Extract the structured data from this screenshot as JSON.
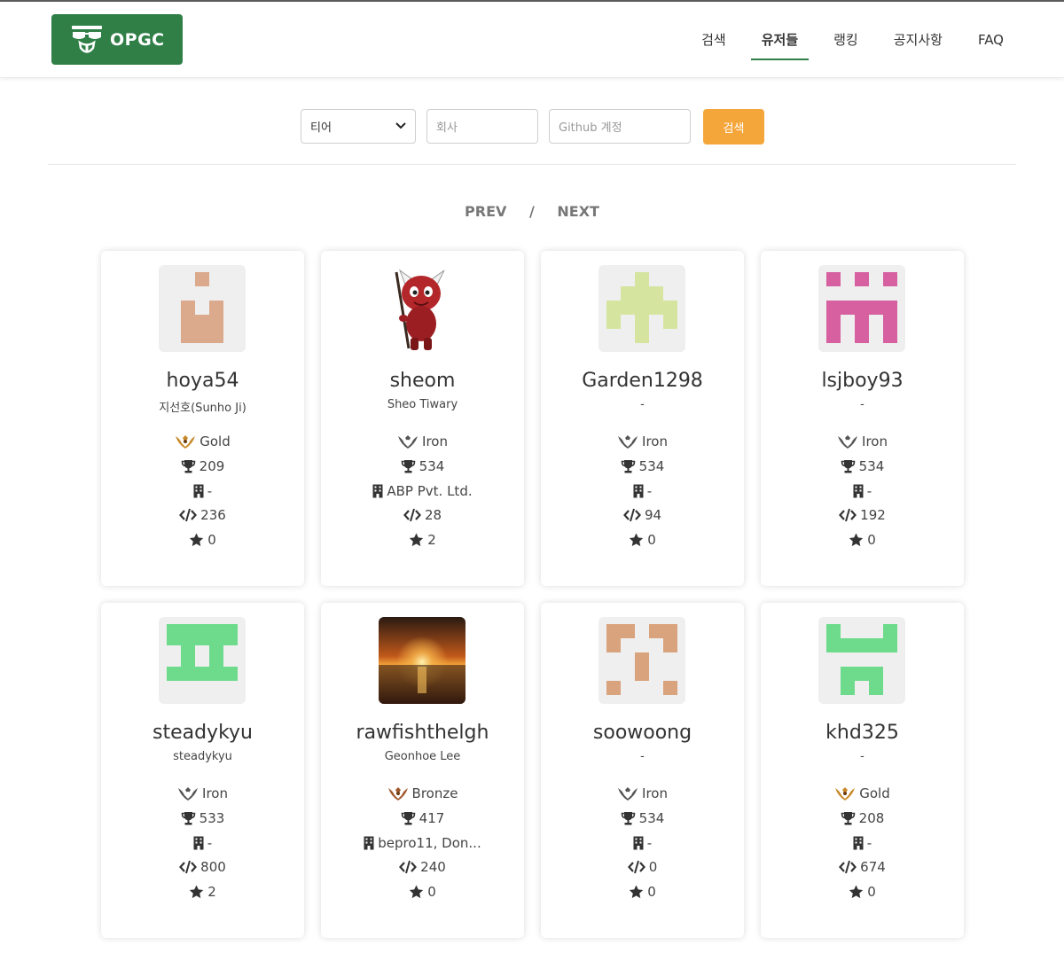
{
  "header": {
    "logo_text": "OPGC",
    "nav": [
      {
        "label": "검색",
        "active": false
      },
      {
        "label": "유저들",
        "active": true
      },
      {
        "label": "랭킹",
        "active": false
      },
      {
        "label": "공지사항",
        "active": false
      },
      {
        "label": "FAQ",
        "active": false
      }
    ]
  },
  "search": {
    "tier_selected": "티어",
    "company_placeholder": "회사",
    "github_placeholder": "Github 계정",
    "button_label": "검색"
  },
  "pager": {
    "prev": "PREV",
    "separator": "/",
    "next": "NEXT"
  },
  "users": [
    {
      "username": "hoya54",
      "realname": "지선호(Sunho Ji)",
      "tier": "Gold",
      "tier_icon": "gold-wings",
      "rank": "209",
      "company": "-",
      "commits": "236",
      "stars": "0",
      "avatar": "identicon-peach"
    },
    {
      "username": "sheom",
      "realname": "Sheo Tiwary",
      "tier": "Iron",
      "tier_icon": "iron-wings",
      "rank": "534",
      "company": "ABP Pvt. Ltd.",
      "commits": "28",
      "stars": "2",
      "avatar": "devil-mascot"
    },
    {
      "username": "Garden1298",
      "realname": "-",
      "tier": "Iron",
      "tier_icon": "iron-wings",
      "rank": "534",
      "company": "-",
      "commits": "94",
      "stars": "0",
      "avatar": "identicon-lime"
    },
    {
      "username": "lsjboy93",
      "realname": "-",
      "tier": "Iron",
      "tier_icon": "iron-wings",
      "rank": "534",
      "company": "-",
      "commits": "192",
      "stars": "0",
      "avatar": "identicon-pink"
    },
    {
      "username": "steadykyu",
      "realname": "steadykyu",
      "tier": "Iron",
      "tier_icon": "iron-wings",
      "rank": "533",
      "company": "-",
      "commits": "800",
      "stars": "2",
      "avatar": "identicon-green"
    },
    {
      "username": "rawfishthelgh",
      "realname": "Geonhoe Lee",
      "tier": "Bronze",
      "tier_icon": "bronze-wings",
      "rank": "417",
      "company": "bepro11, Don...",
      "commits": "240",
      "stars": "0",
      "avatar": "sunset-photo"
    },
    {
      "username": "soowoong",
      "realname": "-",
      "tier": "Iron",
      "tier_icon": "iron-wings",
      "rank": "534",
      "company": "-",
      "commits": "0",
      "stars": "0",
      "avatar": "identicon-tan"
    },
    {
      "username": "khd325",
      "realname": "-",
      "tier": "Gold",
      "tier_icon": "gold-wings",
      "rank": "208",
      "company": "-",
      "commits": "674",
      "stars": "0",
      "avatar": "identicon-green2"
    }
  ],
  "colors": {
    "brand_green": "#2f7f47",
    "search_button": "#f5a63b",
    "gold": "#c8892a",
    "iron": "#555555",
    "bronze": "#a0582e"
  }
}
